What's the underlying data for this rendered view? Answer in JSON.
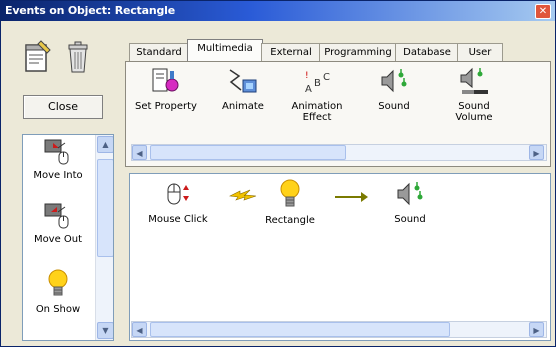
{
  "window": {
    "title": "Events on Object: Rectangle",
    "close_glyph": "✕"
  },
  "left_panel": {
    "close_label": "Close",
    "events": [
      {
        "label": "Move Into",
        "icon": "move-into-icon"
      },
      {
        "label": "Move Out",
        "icon": "move-out-icon"
      },
      {
        "label": "On Show",
        "icon": "on-show-icon"
      }
    ]
  },
  "tabs": [
    "Standard",
    "Multimedia",
    "External",
    "Programming",
    "Database",
    "User"
  ],
  "active_tab": "Multimedia",
  "palette": [
    {
      "label": "Set Property",
      "icon": "set-property-icon"
    },
    {
      "label": "Animate",
      "icon": "animate-icon"
    },
    {
      "label": "Animation Effect",
      "icon": "animation-effect-icon"
    },
    {
      "label": "Sound",
      "icon": "sound-icon"
    },
    {
      "label": "Sound Volume",
      "icon": "sound-volume-icon"
    }
  ],
  "flow": {
    "trigger": {
      "label": "Mouse Click",
      "icon": "mouse-click-icon"
    },
    "object": {
      "label": "Rectangle",
      "icon": "lightbulb-icon"
    },
    "action": {
      "label": "Sound",
      "icon": "sound-icon"
    }
  },
  "colors": {
    "title_bar_start": "#0a246a",
    "title_bar_end": "#a6caf0",
    "window_bg": "#ece9d8",
    "close_button": "#e0553a"
  }
}
